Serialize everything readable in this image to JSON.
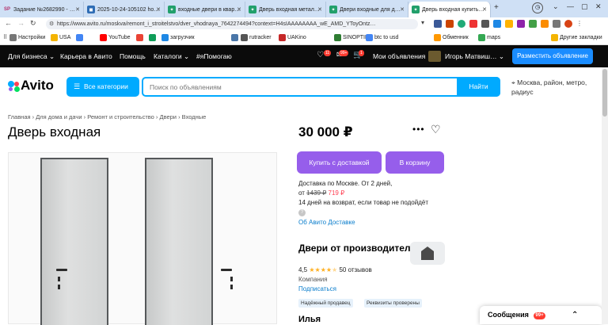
{
  "browser": {
    "tabs": [
      {
        "label": "Задание №2682990 - …",
        "favicon": "SP",
        "color": "#b3306b"
      },
      {
        "label": "2025-10-24-105102 ho…",
        "favicon": "ИК",
        "color": "#2f6db5"
      },
      {
        "label": "входные двери в квар…",
        "favicon": "",
        "color": "#22a06b"
      },
      {
        "label": "Дверь входная метал…",
        "favicon": "",
        "color": "#22a06b"
      },
      {
        "label": "Двери входные для д…",
        "favicon": "",
        "color": "#22a06b"
      },
      {
        "label": "Дверь входная купить…",
        "favicon": "",
        "color": "#22a06b"
      }
    ],
    "url": "https://www.avito.ru/moskva/remont_i_stroitelstvo/dver_vhodnaya_7642274494?context=H4sIAAAAAAAA_wE_AMD_YToyOntz…",
    "bookmarks": [
      "Настройки",
      "USA",
      "",
      "YouTube",
      "",
      "",
      "загрузчик",
      "",
      "rutracker",
      "UAKino",
      "",
      "",
      "SINOPTIK",
      "btc to usd",
      "",
      "",
      "Обменник",
      "maps",
      "Другие закладки"
    ]
  },
  "topbar": {
    "business": "Для бизнеса",
    "career": "Карьера в Авито",
    "help": "Помощь",
    "catalogs": "Каталоги",
    "helping": "#яПомогаю",
    "notif_count": "11",
    "msg_count": "99+",
    "cart_count": "1",
    "my_ads": "Мои объявления",
    "user": "Игорь Матвиш…",
    "post_ad": "Разместить объявление"
  },
  "search": {
    "logo": "Avito",
    "categories": "Все категории",
    "placeholder": "Поиск по объявлениям",
    "find": "Найти",
    "location": "Москва, район, метро, радиус"
  },
  "listing": {
    "breadcrumb": "Главная › Для дома и дачи › Ремонт и строительство › Двери › Входные",
    "title": "Дверь входная",
    "price": "30 000 ₽",
    "buy_delivery": "Купить с доставкой",
    "to_cart": "В корзину",
    "delivery_line1": "Доставка по Москве. От 2 дней,",
    "delivery_from": "от",
    "old_price": "1439 ₽",
    "new_price": "719 ₽",
    "return_line": "14 дней на возврат, если товар не подойдёт",
    "avito_delivery": "Об Авито Доставке"
  },
  "seller": {
    "name": "Двери от производителя",
    "rating": "4,5",
    "reviews": "50 отзывов",
    "type": "Компания",
    "subscribe": "Подписаться",
    "chips": [
      "Надёжный продавец",
      "Реквизиты проверены"
    ],
    "next_name": "Илья"
  },
  "messages": {
    "label": "Сообщения",
    "count": "99+"
  },
  "colors": {
    "avito_blue": "#00aaff",
    "purple": "#965eeb",
    "dark_bar": "#0b0b0b",
    "post_ad": "#1a8cff"
  }
}
